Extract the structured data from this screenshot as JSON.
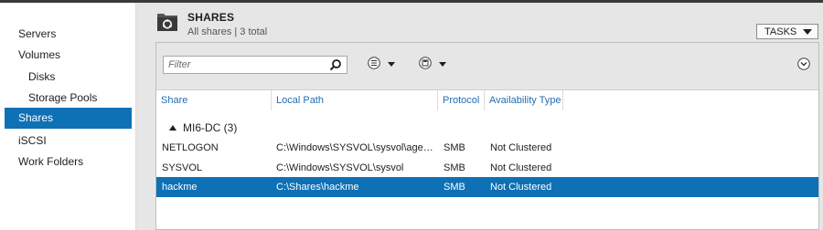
{
  "sidebar": {
    "items": [
      {
        "label": "Servers",
        "selected": false
      },
      {
        "label": "Volumes",
        "selected": false
      },
      {
        "label": "Disks",
        "selected": false
      },
      {
        "label": "Storage Pools",
        "selected": false
      },
      {
        "label": "Shares",
        "selected": true
      },
      {
        "label": "iSCSI",
        "selected": false
      },
      {
        "label": "Work Folders",
        "selected": false
      }
    ]
  },
  "header": {
    "title": "SHARES",
    "subtitle": "All shares | 3 total",
    "tasks_label": "TASKS"
  },
  "toolbar": {
    "filter_placeholder": "Filter",
    "icons": [
      "search-icon",
      "list-options-icon",
      "save-query-icon",
      "expand-icon"
    ]
  },
  "table": {
    "columns": [
      "Share",
      "Local Path",
      "Protocol",
      "Availability Type"
    ],
    "group": "MI6-DC (3)",
    "rows": [
      {
        "share": "NETLOGON",
        "path": "C:\\Windows\\SYSVOL\\sysvol\\agent...",
        "protocol": "SMB",
        "availability": "Not Clustered",
        "selected": false
      },
      {
        "share": "SYSVOL",
        "path": "C:\\Windows\\SYSVOL\\sysvol",
        "protocol": "SMB",
        "availability": "Not Clustered",
        "selected": false
      },
      {
        "share": "hackme",
        "path": "C:\\Shares\\hackme",
        "protocol": "SMB",
        "availability": "Not Clustered",
        "selected": true
      }
    ]
  },
  "colors": {
    "selection": "#0e70b5",
    "header_link": "#1f6db3",
    "panel_bg": "#e6e6e6"
  }
}
